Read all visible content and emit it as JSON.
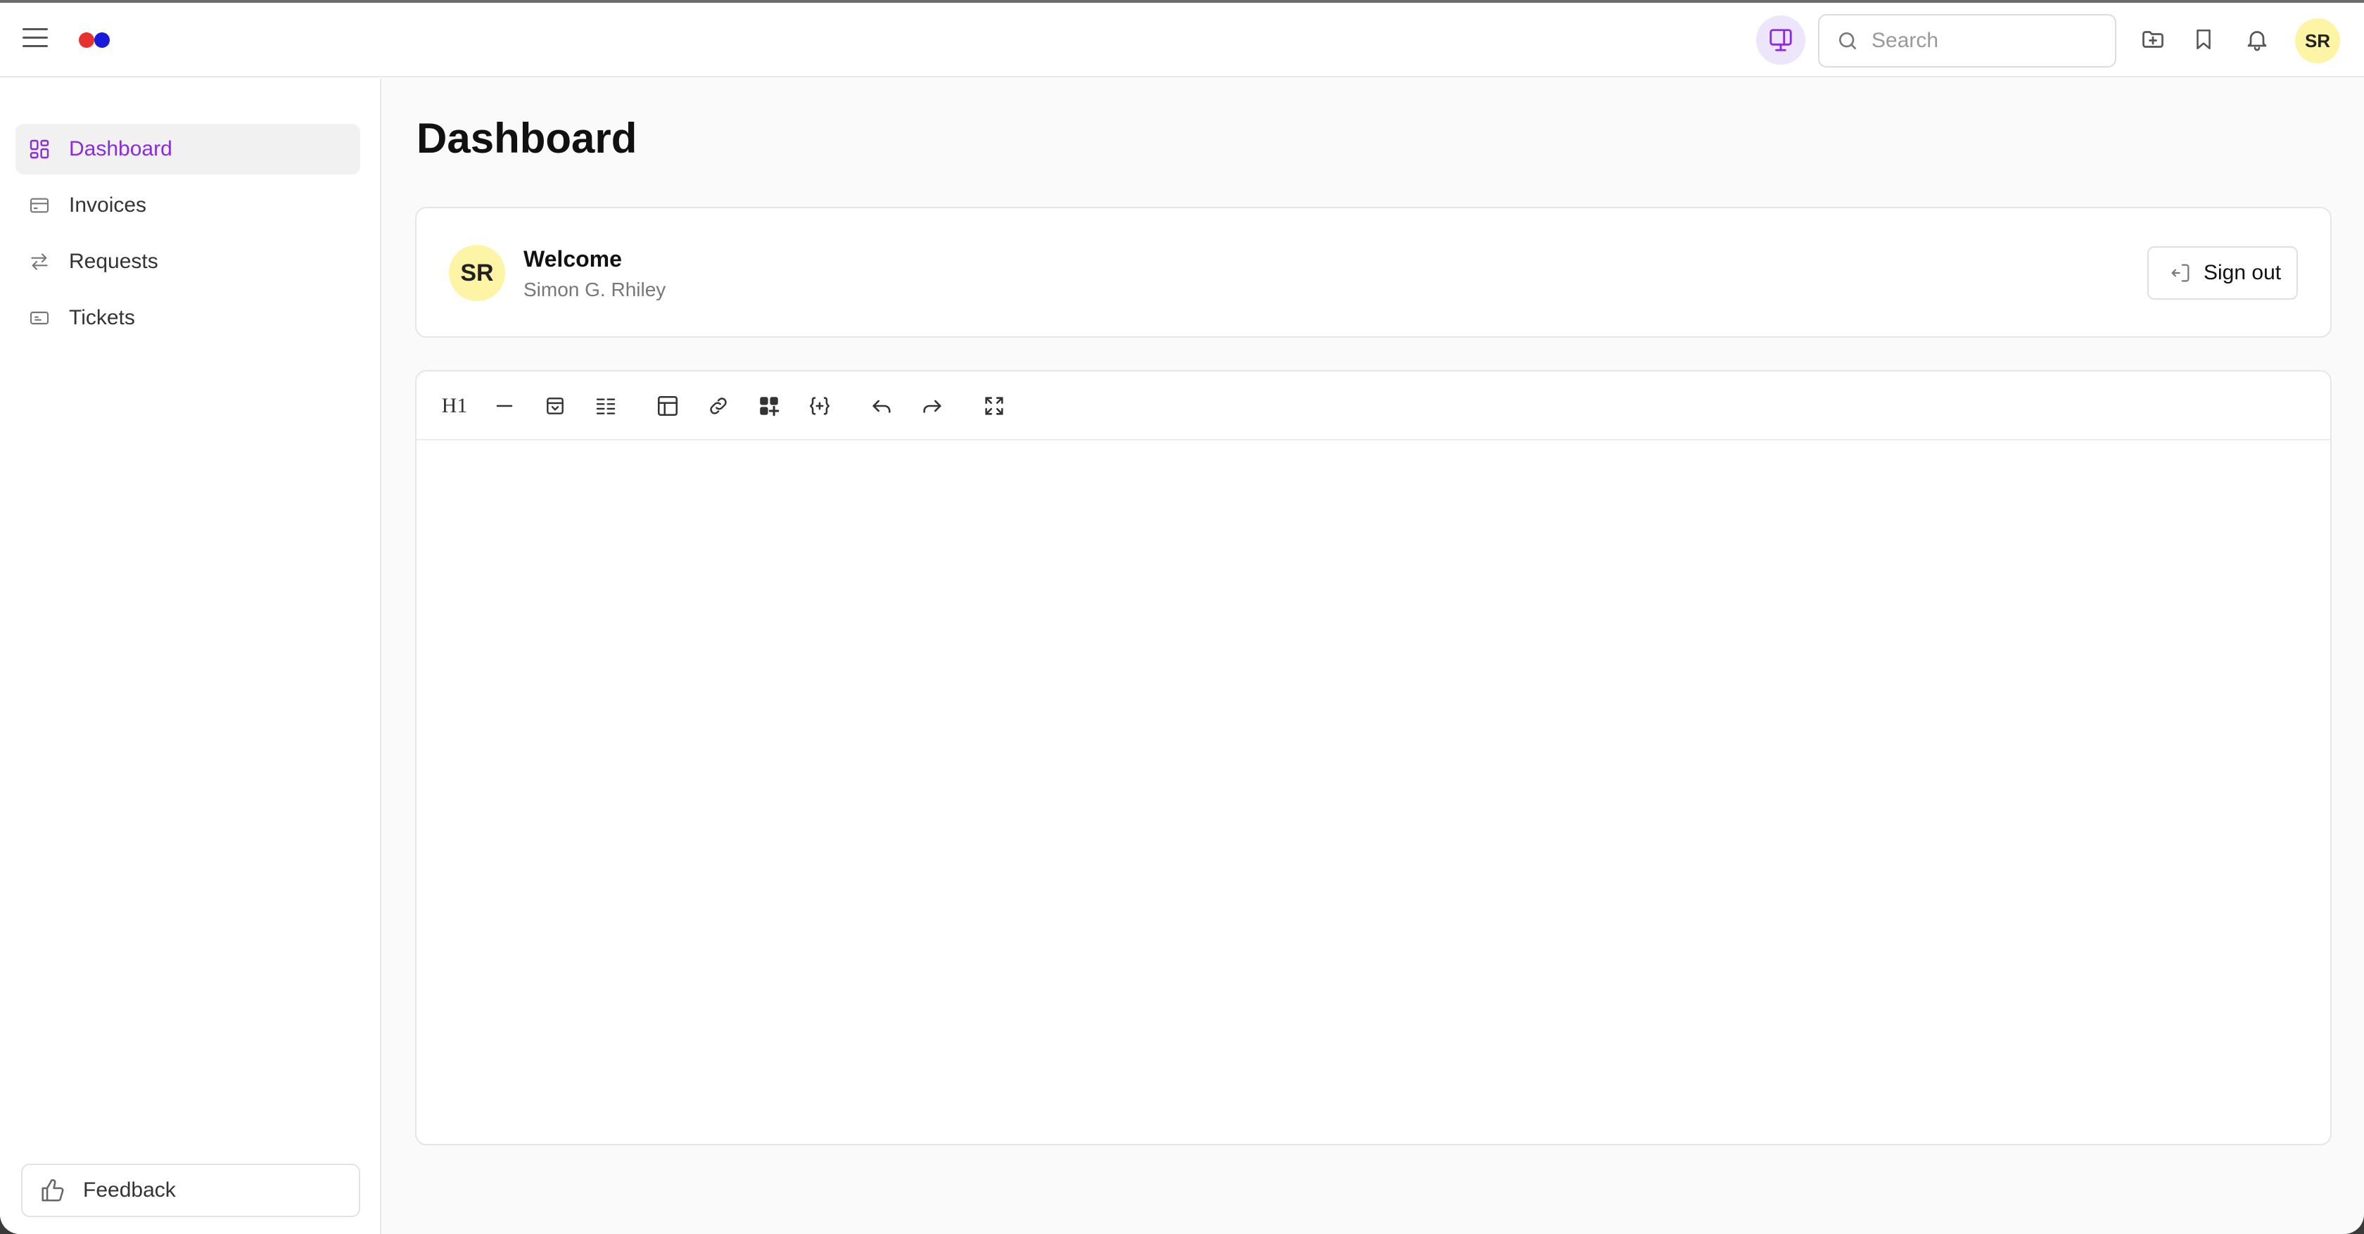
{
  "header": {
    "search_placeholder": "Search",
    "user_initials": "SR"
  },
  "sidebar": {
    "items": [
      {
        "label": "Dashboard",
        "icon": "dashboard-icon",
        "active": true
      },
      {
        "label": "Invoices",
        "icon": "card-icon"
      },
      {
        "label": "Requests",
        "icon": "arrows-icon"
      },
      {
        "label": "Tickets",
        "icon": "ticket-icon"
      }
    ],
    "feedback_label": "Feedback"
  },
  "main": {
    "title": "Dashboard",
    "welcome": {
      "avatar_initials": "SR",
      "title": "Welcome",
      "name": "Simon G. Rhiley",
      "signout_label": "Sign out"
    },
    "editor": {
      "heading_label": "H1"
    }
  },
  "colors": {
    "accent": "#8a2be2",
    "avatar_bg": "#fdf4a6",
    "logo_red": "#e8302c",
    "logo_blue": "#1a1adb"
  }
}
